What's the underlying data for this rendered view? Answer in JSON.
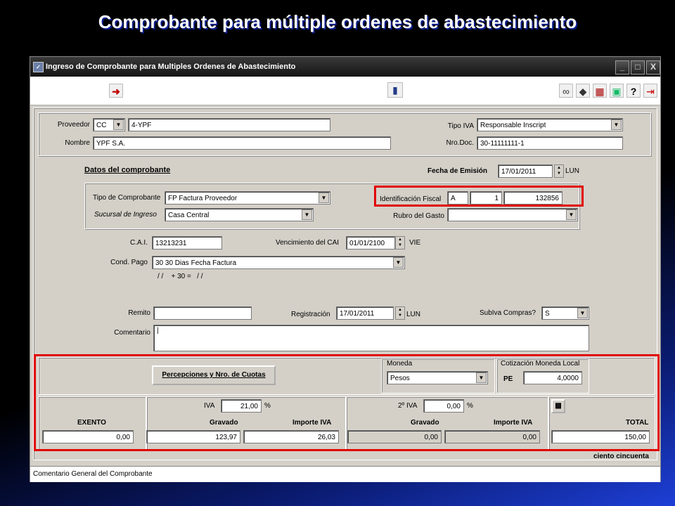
{
  "slide_title": "Comprobante para múltiple ordenes de abastecimiento",
  "window": {
    "title": "Ingreso de Comprobante para Multiples Ordenes de Abastecimiento",
    "controls": [
      "_",
      "□",
      "X"
    ]
  },
  "toolbar": {
    "left_icons": [
      "arrow-right-icon"
    ],
    "center_icons": [
      "save-icon"
    ],
    "right_icons": [
      "binoculars-icon",
      "tag-icon",
      "calculator-icon",
      "monitor-icon",
      "help-icon",
      "exit-icon"
    ]
  },
  "header": {
    "proveedor_label": "Proveedor",
    "proveedor_tipo": "CC",
    "proveedor_codigo": "4-YPF",
    "nombre_label": "Nombre",
    "nombre": "YPF S.A.",
    "tipo_iva_label": "Tipo IVA",
    "tipo_iva": "Responsable Inscript",
    "nro_doc_label": "Nro.Doc.",
    "nro_doc": "30-11111111-1"
  },
  "comprobante": {
    "section_title": "Datos del comprobante",
    "fecha_emision_label": "Fecha de Emisión",
    "fecha_emision": "17/01/2011",
    "fecha_emision_dia": "LUN",
    "tipo_label": "Tipo de Comprobante",
    "tipo": "FP Factura Proveedor",
    "sucursal_label": "Sucursal de Ingreso",
    "sucursal": "Casa Central",
    "id_fiscal_label": "Identificación Fiscal",
    "id_fiscal_letra": "A",
    "id_fiscal_pv": "1",
    "id_fiscal_numero": "132856",
    "rubro_label": "Rubro del Gasto",
    "rubro": ""
  },
  "cai": {
    "cai_label": "C.A.I.",
    "cai": "13213231",
    "venc_label": "Vencimiento del CAI",
    "venc": "01/01/2100",
    "venc_dia": "VIE",
    "cond_pago_label": "Cond. Pago",
    "cond_pago": "30 30 Dias Fecha Factura",
    "cond_pago_detalle": "/ /    + 30 =   / /"
  },
  "otros": {
    "remito_label": "Remito",
    "remito": "",
    "registracion_label": "Registración",
    "registracion": "17/01/2011",
    "registracion_dia": "LUN",
    "subiva_label": "SubIva Compras?",
    "subiva": "S",
    "comentario_label": "Comentario",
    "comentario": "|"
  },
  "totales": {
    "percepciones_button": "Percepciones  y Nro. de Cuotas",
    "moneda_label": "Moneda",
    "moneda": "Pesos",
    "cotizacion_label": "Cotización Moneda Local",
    "cotizacion_moneda": "PE",
    "cotizacion": "4,0000",
    "exento_label": "EXENTO",
    "exento": "0,00",
    "iva_label": "IVA",
    "iva_pct": "21,00",
    "pct_sign": "%",
    "gravado_label": "Gravado",
    "gravado": "123,97",
    "importe_iva_label": "Importe IVA",
    "importe_iva": "26,03",
    "iva2_label": "2º IVA",
    "iva2_pct": "0,00",
    "gravado2": "0,00",
    "importe_iva2": "0,00",
    "total_label": "TOTAL",
    "total": "150,00",
    "total_letras": "ciento cincuenta"
  },
  "status": {
    "comentario_general": "Comentario General del Comprobante"
  },
  "colors": {
    "highlight": "#e00000",
    "window_bg": "#d4d0c8",
    "title_text": "#ffffff"
  }
}
